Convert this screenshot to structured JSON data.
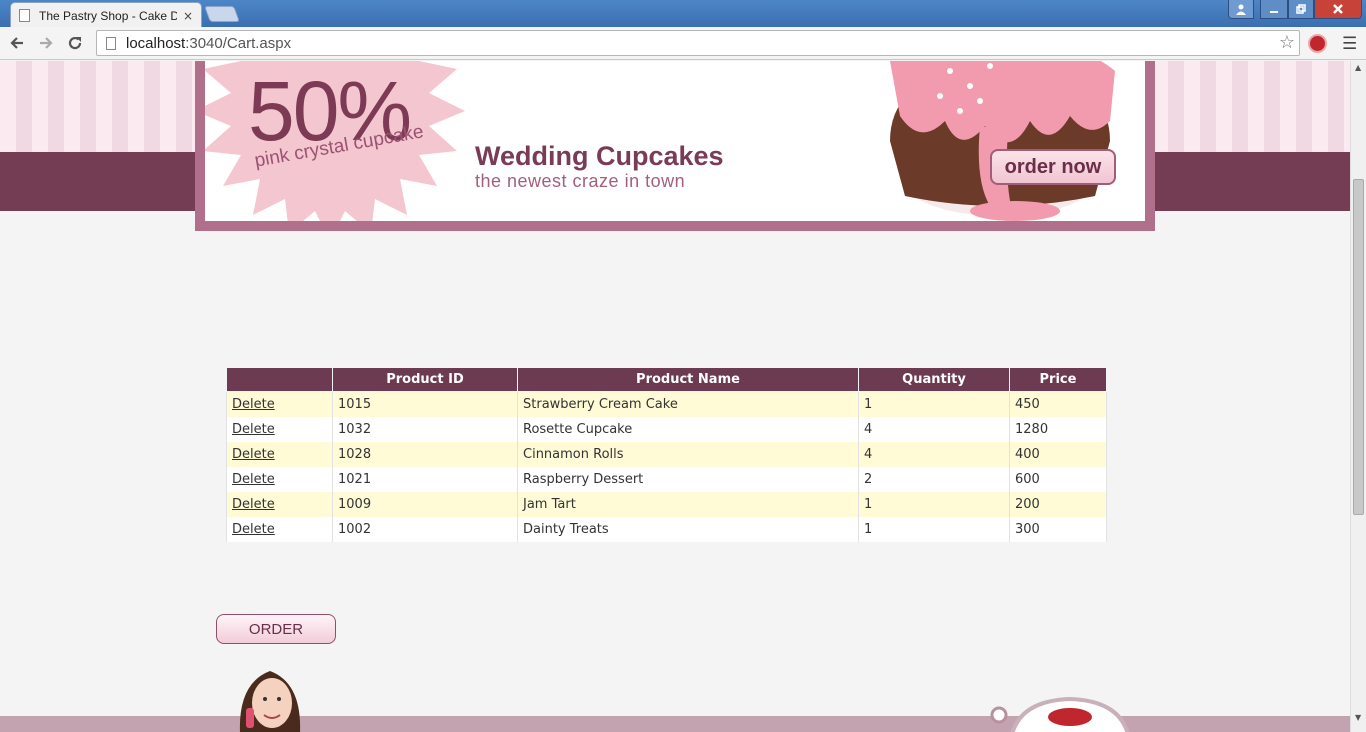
{
  "browser": {
    "tab_title": "The Pastry Shop - Cake De",
    "tab_close": "×",
    "url_host": "localhost",
    "url_path": ":3040/Cart.aspx"
  },
  "banner": {
    "discount": "50%",
    "discount_caption": "pink crystal cupcake",
    "title": "Wedding Cupcakes",
    "subtitle": "the newest craze in town",
    "order_now_label": "order now"
  },
  "cart": {
    "headers": [
      "",
      "Product ID",
      "Product Name",
      "Quantity",
      "Price"
    ],
    "delete_label": "Delete",
    "rows": [
      {
        "id": "1015",
        "name": "Strawberry Cream Cake",
        "quantity": "1",
        "price": "450"
      },
      {
        "id": "1032",
        "name": "Rosette Cupcake",
        "quantity": "4",
        "price": "1280"
      },
      {
        "id": "1028",
        "name": "Cinnamon Rolls",
        "quantity": "4",
        "price": "400"
      },
      {
        "id": "1021",
        "name": "Raspberry Dessert",
        "quantity": "2",
        "price": "600"
      },
      {
        "id": "1009",
        "name": "Jam Tart",
        "quantity": "1",
        "price": "200"
      },
      {
        "id": "1002",
        "name": "Dainty Treats",
        "quantity": "1",
        "price": "300"
      }
    ]
  },
  "order_button_label": "ORDER",
  "colors": {
    "brand": "#743d54",
    "header_bg": "#6d3b51",
    "row_alt": "#fffbd6",
    "banner_frame": "#b0708c"
  },
  "icons": [
    "page-icon",
    "back-arrow-icon",
    "forward-arrow-icon",
    "reload-icon",
    "star-icon",
    "extension-icon",
    "menu-icon",
    "user-icon"
  ]
}
